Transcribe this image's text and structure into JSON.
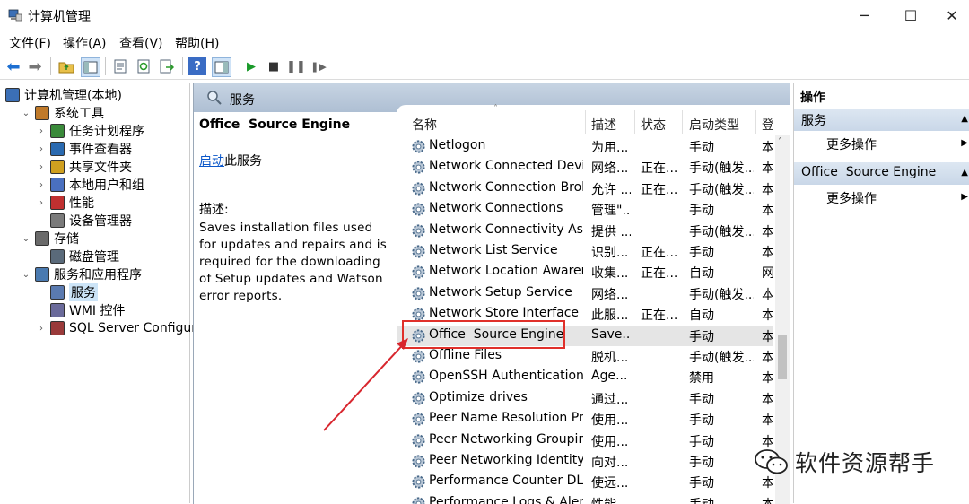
{
  "window": {
    "title": "计算机管理"
  },
  "menu": [
    "文件(F)",
    "操作(A)",
    "查看(V)",
    "帮助(H)"
  ],
  "tree": [
    {
      "label": "计算机管理(本地)",
      "level": 0,
      "twisty": "",
      "icon": "computer-management-icon"
    },
    {
      "label": "系统工具",
      "level": 1,
      "twisty": "v",
      "icon": "system-tools-icon"
    },
    {
      "label": "任务计划程序",
      "level": 2,
      "twisty": ">",
      "icon": "task-scheduler-icon"
    },
    {
      "label": "事件查看器",
      "level": 2,
      "twisty": ">",
      "icon": "event-viewer-icon"
    },
    {
      "label": "共享文件夹",
      "level": 2,
      "twisty": ">",
      "icon": "shared-folders-icon"
    },
    {
      "label": "本地用户和组",
      "level": 2,
      "twisty": ">",
      "icon": "local-users-icon"
    },
    {
      "label": "性能",
      "level": 2,
      "twisty": ">",
      "icon": "performance-icon"
    },
    {
      "label": "设备管理器",
      "level": 2,
      "twisty": "",
      "icon": "device-manager-icon"
    },
    {
      "label": "存储",
      "level": 1,
      "twisty": "v",
      "icon": "storage-icon"
    },
    {
      "label": "磁盘管理",
      "level": 2,
      "twisty": "",
      "icon": "disk-management-icon"
    },
    {
      "label": "服务和应用程序",
      "level": 1,
      "twisty": "v",
      "icon": "services-apps-icon"
    },
    {
      "label": "服务",
      "level": 2,
      "twisty": "",
      "icon": "services-icon",
      "selected": true
    },
    {
      "label": "WMI 控件",
      "level": 2,
      "twisty": "",
      "icon": "wmi-icon"
    },
    {
      "label": "SQL Server Configurati",
      "level": 2,
      "twisty": ">",
      "icon": "sql-server-icon"
    }
  ],
  "center": {
    "header": "服务",
    "detail": {
      "name": "Office  Source Engine",
      "start_link": "启动",
      "start_suffix": "此服务",
      "desc_label": "描述:",
      "desc": "Saves installation files used for updates and repairs and is required for the downloading of Setup updates and Watson error reports."
    },
    "columns": [
      "名称",
      "描述",
      "状态",
      "启动类型",
      "登"
    ],
    "rows": [
      {
        "name": "Netlogon",
        "desc": "为用...",
        "status": "",
        "startup": "手动",
        "logon": "本"
      },
      {
        "name": "Network Connected Devic...",
        "desc": "网络...",
        "status": "正在...",
        "startup": "手动(触发...",
        "logon": "本"
      },
      {
        "name": "Network Connection Broker",
        "desc": "允许 ...",
        "status": "正在...",
        "startup": "手动(触发...",
        "logon": "本"
      },
      {
        "name": "Network Connections",
        "desc": "管理\"...",
        "status": "",
        "startup": "手动",
        "logon": "本"
      },
      {
        "name": "Network Connectivity Assis...",
        "desc": "提供 ...",
        "status": "",
        "startup": "手动(触发...",
        "logon": "本"
      },
      {
        "name": "Network List Service",
        "desc": "识别...",
        "status": "正在...",
        "startup": "手动",
        "logon": "本"
      },
      {
        "name": "Network Location Awarene...",
        "desc": "收集...",
        "status": "正在...",
        "startup": "自动",
        "logon": "网"
      },
      {
        "name": "Network Setup Service",
        "desc": "网络...",
        "status": "",
        "startup": "手动(触发...",
        "logon": "本"
      },
      {
        "name": "Network Store Interface Se...",
        "desc": "此服...",
        "status": "正在...",
        "startup": "自动",
        "logon": "本"
      },
      {
        "name": "Office  Source Engine",
        "desc": "Save...",
        "status": "",
        "startup": "手动",
        "logon": "本",
        "selected": true
      },
      {
        "name": "Offline Files",
        "desc": "脱机...",
        "status": "",
        "startup": "手动(触发...",
        "logon": "本"
      },
      {
        "name": "OpenSSH Authentication ...",
        "desc": "Age...",
        "status": "",
        "startup": "禁用",
        "logon": "本"
      },
      {
        "name": "Optimize drives",
        "desc": "通过...",
        "status": "",
        "startup": "手动",
        "logon": "本"
      },
      {
        "name": "Peer Name Resolution Pro...",
        "desc": "使用...",
        "status": "",
        "startup": "手动",
        "logon": "本"
      },
      {
        "name": "Peer Networking Grouping",
        "desc": "使用...",
        "status": "",
        "startup": "手动",
        "logon": "本"
      },
      {
        "name": "Peer Networking Identity ...",
        "desc": "向对...",
        "status": "",
        "startup": "手动",
        "logon": "本"
      },
      {
        "name": "Performance Counter DLL ...",
        "desc": "使远...",
        "status": "",
        "startup": "手动",
        "logon": "本"
      },
      {
        "name": "Performance Logs & Alerts",
        "desc": "性能...",
        "status": "",
        "startup": "手动",
        "logon": "本"
      }
    ]
  },
  "actions": {
    "title": "操作",
    "section1": "服务",
    "more1": "更多操作",
    "section2": "Office  Source Engine",
    "more2": "更多操作"
  },
  "watermark": "软件资源帮手",
  "colors": {
    "highlight_box": "#e0302a",
    "arrow": "#d8262e",
    "link": "#0b57c9",
    "header_blue": "#b9c9dc"
  }
}
